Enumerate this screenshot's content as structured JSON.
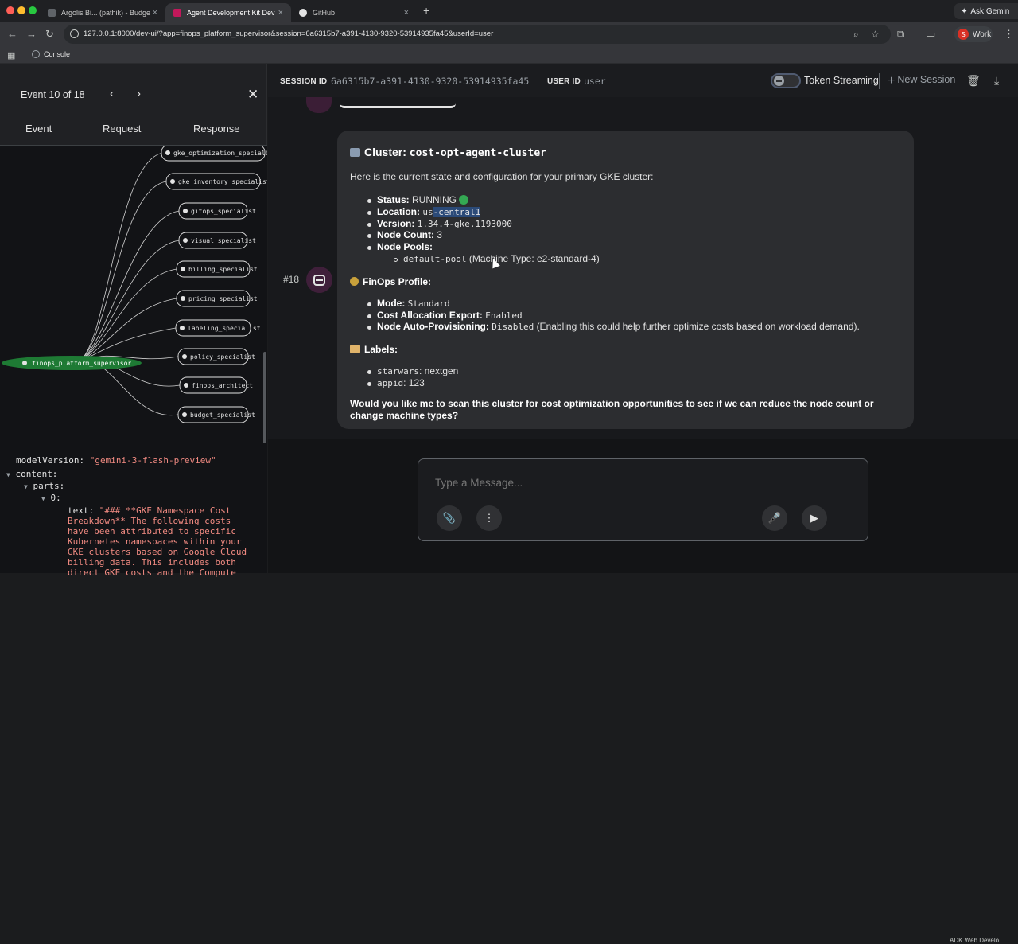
{
  "browser": {
    "tabs": [
      {
        "title": "Argolis Bi... (pathik) - Budget",
        "icon_color": "#5f6368"
      },
      {
        "title": "Agent Development Kit Dev U",
        "icon_color": "#c2185b"
      },
      {
        "title": "GitHub",
        "icon_color": "#e3e3e3"
      }
    ],
    "new_tab": "+",
    "ask_gemini": "Ask Gemin",
    "url": "127.0.0.1:8000/dev-ui/?app=finops_platform_supervisor&session=6a6315b7-a391-4130-9320-53914935fa45&userId=user",
    "profile_initial": "S",
    "profile_label": "Work",
    "bookmark_console": "Console"
  },
  "left_panel": {
    "event_counter": "Event 10 of 18",
    "tabs": [
      "Event",
      "Request",
      "Response"
    ],
    "graph": {
      "root": "finops_platform_supervisor",
      "children": [
        "gke_optimization_specialist",
        "gke_inventory_specialist",
        "gitops_specialist",
        "visual_specialist",
        "billing_specialist",
        "pricing_specialist",
        "labeling_specialist",
        "policy_specialist",
        "finops_architect",
        "budget_specialist"
      ]
    },
    "json": {
      "model_version_key": "modelVersion:",
      "model_version_value": "\"gemini-3-flash-preview\"",
      "content_key": "content:",
      "parts_key": "parts:",
      "index_key": "0:",
      "text_key": "text:",
      "text_lines": [
        "\"### **GKE Namespace Cost",
        "Breakdown** The following costs",
        "have been attributed to specific",
        "Kubernetes namespaces within your",
        "GKE clusters based on Google Cloud",
        "billing data. This includes both",
        "direct GKE costs and the Compute"
      ]
    }
  },
  "header": {
    "session_label": "SESSION ID",
    "session_id": "6a6315b7-a391-4130-9320-53914935fa45",
    "user_label": "USER ID",
    "user_id": "user",
    "token_streaming": "Token Streaming",
    "new_session": "New Session"
  },
  "message": {
    "number": "#18",
    "title_prefix": "Cluster: ",
    "title_cluster": "cost-opt-agent-cluster",
    "intro": "Here is the current state and configuration for your primary GKE cluster:",
    "status_label": "Status:",
    "status_value": "RUNNING",
    "location_label": "Location:",
    "location_value_a": "us",
    "location_value_b": "-central1",
    "version_label": "Version:",
    "version_value": "1.34.4-gke.1193000",
    "node_count_label": "Node Count:",
    "node_count_value": "3",
    "node_pools_label": "Node Pools:",
    "pool_name": "default-pool",
    "pool_detail": "(Machine Type: e2-standard-4)",
    "finops_heading": "FinOps Profile:",
    "mode_label": "Mode:",
    "mode_value": "Standard",
    "cost_export_label": "Cost Allocation Export:",
    "cost_export_value": "Enabled",
    "nap_label": "Node Auto-Provisioning:",
    "nap_value": "Disabled",
    "nap_note": "(Enabling this could help further optimize costs based on workload demand).",
    "labels_heading": "Labels:",
    "label_1_key": "starwars",
    "label_1_value": ": nextgen",
    "label_2_key": "appid",
    "label_2_value": ": 123",
    "question_line1": "Would you like me to scan this cluster for cost optimization opportunities to see if we can reduce the node count or",
    "question_line2": "change machine types?"
  },
  "composer": {
    "placeholder": "Type a Message..."
  },
  "footer_note": "ADK Web Develo"
}
